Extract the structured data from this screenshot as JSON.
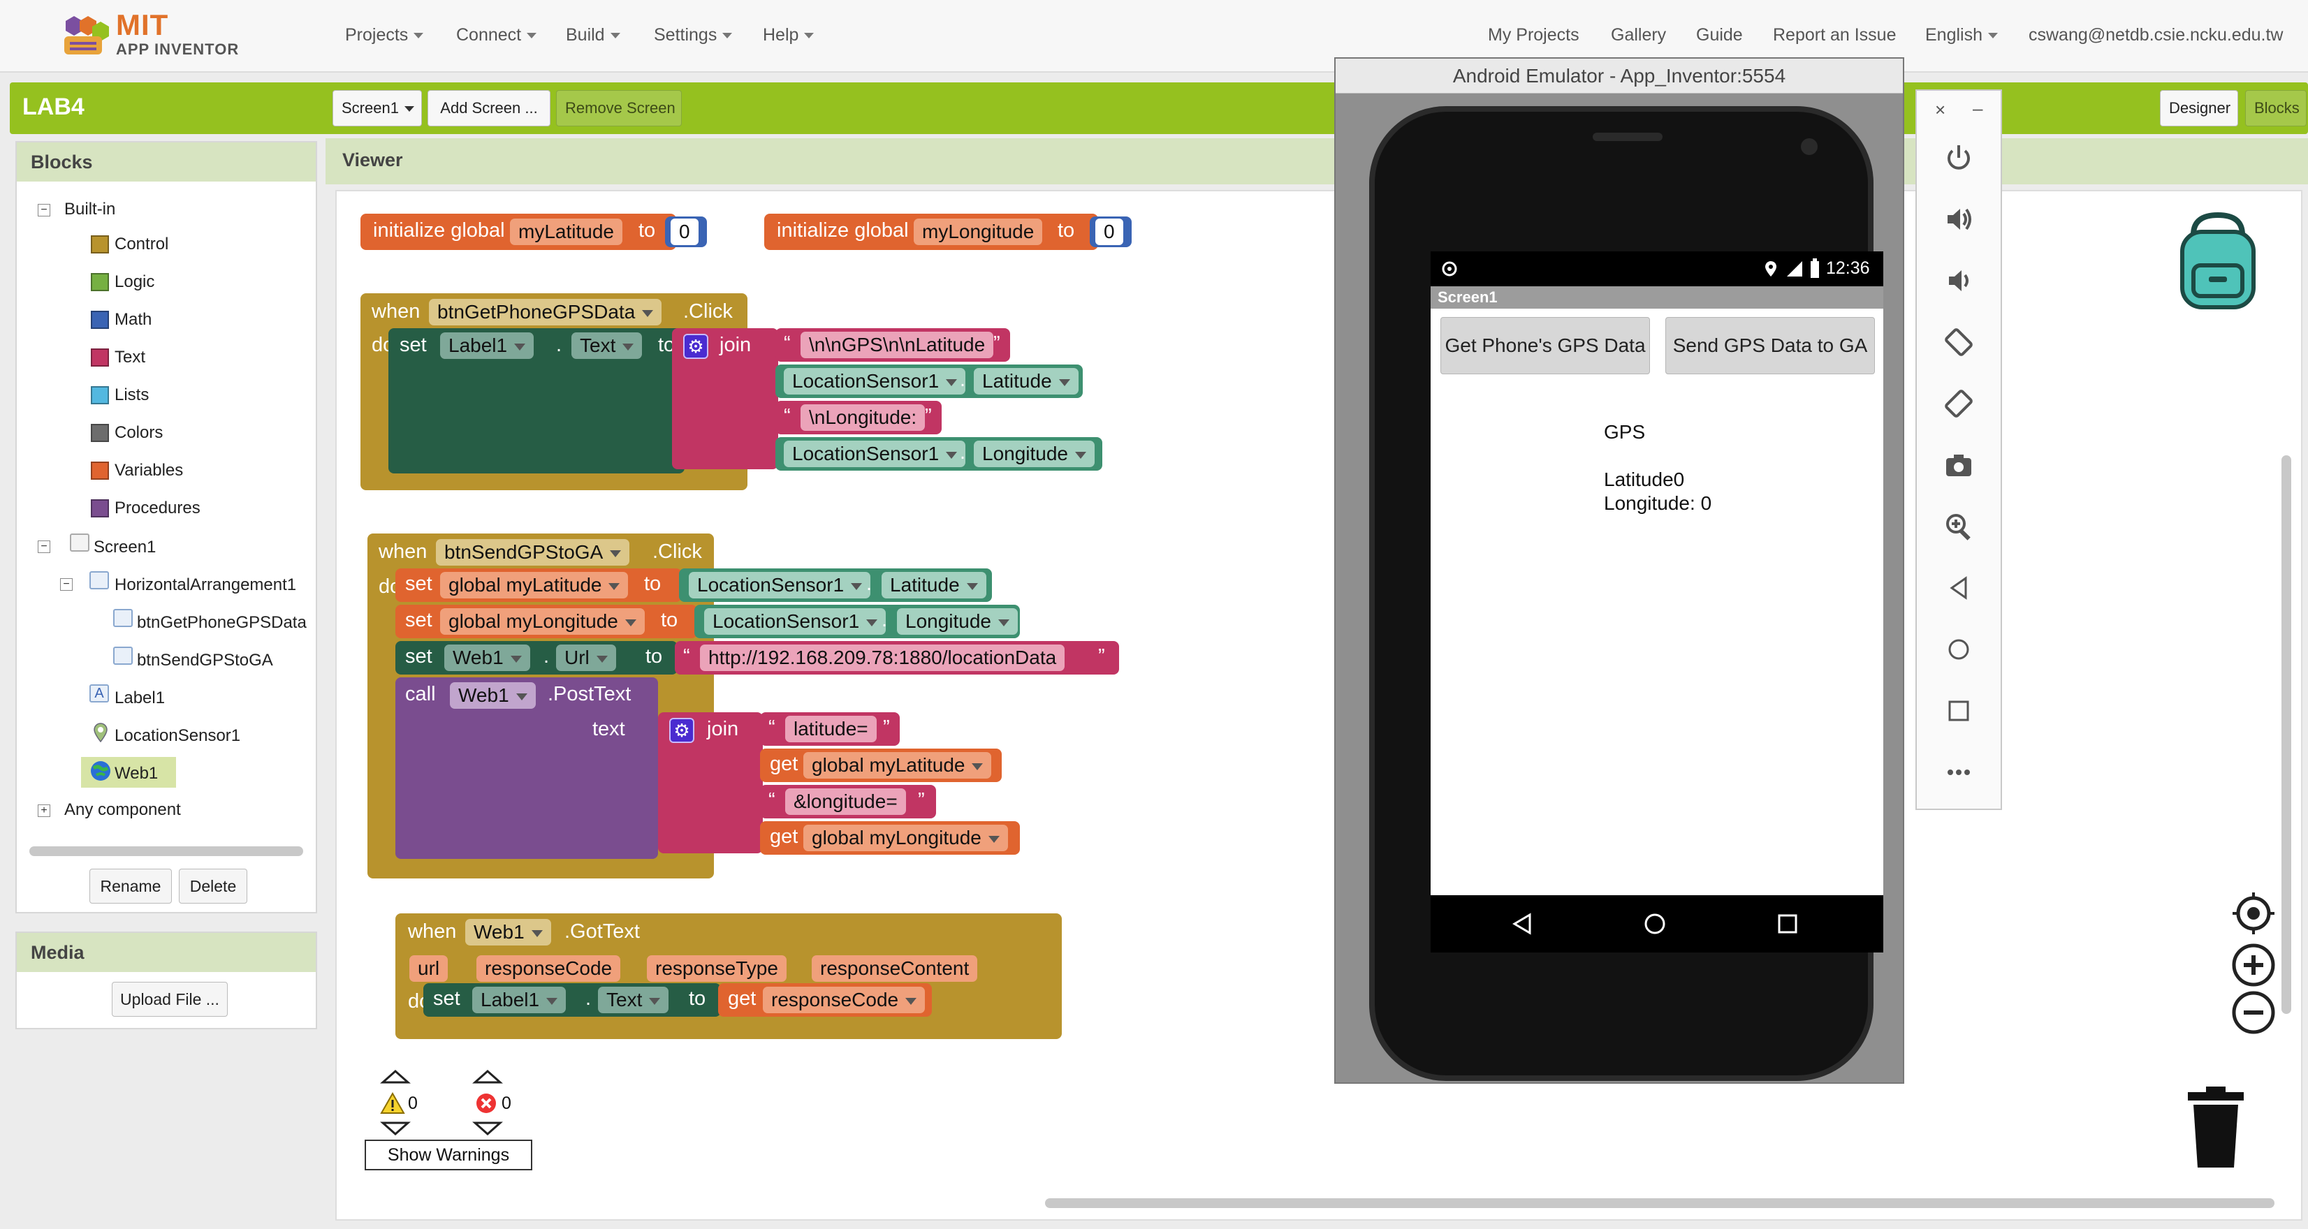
{
  "nav": {
    "logo_mit": "MIT",
    "logo_app": "APP INVENTOR",
    "left_menus": [
      "Projects",
      "Connect",
      "Build",
      "Settings",
      "Help"
    ],
    "right_links": [
      "My Projects",
      "Gallery",
      "Guide",
      "Report an Issue",
      "English",
      "cswang@netdb.csie.ncku.edu.tw"
    ]
  },
  "project": {
    "name": "LAB4",
    "screen_select": "Screen1",
    "add_screen": "Add Screen ...",
    "remove_screen": "Remove Screen",
    "designer": "Designer",
    "blocks": "Blocks"
  },
  "blocks_panel": {
    "title": "Blocks",
    "builtin": "Built-in",
    "builtin_items": [
      {
        "label": "Control",
        "color": "#b8932d"
      },
      {
        "label": "Logic",
        "color": "#76b042"
      },
      {
        "label": "Math",
        "color": "#3a64b4"
      },
      {
        "label": "Text",
        "color": "#c13563"
      },
      {
        "label": "Lists",
        "color": "#53b8e0"
      },
      {
        "label": "Colors",
        "color": "#6d6d6d"
      },
      {
        "label": "Variables",
        "color": "#e0642f"
      },
      {
        "label": "Procedures",
        "color": "#7a4d8f"
      }
    ],
    "screen": "Screen1",
    "components": [
      "HorizontalArrangement1",
      "btnGetPhoneGPSData",
      "btnSendGPStoGA",
      "Label1",
      "LocationSensor1",
      "Web1"
    ],
    "any_component": "Any component",
    "rename": "Rename",
    "delete": "Delete"
  },
  "media_panel": {
    "title": "Media",
    "upload": "Upload File ..."
  },
  "viewer": {
    "title": "Viewer"
  },
  "code": {
    "init1": {
      "kw": "initialize global",
      "name": "myLatitude",
      "to": "to",
      "value": "0"
    },
    "init2": {
      "kw": "initialize global",
      "name": "myLongitude",
      "to": "to",
      "value": "0"
    },
    "ev1": {
      "when": "when",
      "component": "btnGetPhoneGPSData",
      "event": ".Click",
      "do": "do",
      "set": "set",
      "target": "Label1",
      "prop": "Text",
      "to": "to",
      "join": "join",
      "s1": "\\n\\nGPS\\n\\nLatitude",
      "sensor1": "LocationSensor1",
      "p1": "Latitude",
      "s2": "\\nLongitude:",
      "sensor2": "LocationSensor1",
      "p2": "Longitude"
    },
    "ev2": {
      "when": "when",
      "component": "btnSendGPStoGA",
      "event": ".Click",
      "do": "do",
      "set1": "set",
      "var1": "global myLatitude",
      "to1": "to",
      "sensor1": "LocationSensor1",
      "p1": "Latitude",
      "set2": "set",
      "var2": "global myLongitude",
      "to2": "to",
      "sensor2": "LocationSensor1",
      "p2": "Longitude",
      "set3": "set",
      "web": "Web1",
      "prop": "Url",
      "to3": "to",
      "url": "http://192.168.209.78:1880/locationData",
      "call": "call",
      "web2": "Web1",
      "method": ".PostText",
      "text": "text",
      "join": "join",
      "s1": "latitude=",
      "get1": "get",
      "gvar1": "global myLatitude",
      "s2": "&longitude=",
      "get2": "get",
      "gvar2": "global myLongitude"
    },
    "ev3": {
      "when": "when",
      "component": "Web1",
      "event": ".GotText",
      "params": [
        "url",
        "responseCode",
        "responseType",
        "responseContent"
      ],
      "do": "do",
      "set": "set",
      "target": "Label1",
      "prop": "Text",
      "to": "to",
      "get": "get",
      "var": "responseCode"
    }
  },
  "warnings": {
    "warn_count": "0",
    "error_count": "0",
    "show_warnings": "Show Warnings"
  },
  "emulator": {
    "title": "Android Emulator - App_Inventor:5554",
    "time": "12:36",
    "app_title": "Screen1",
    "btn1": "Get Phone's GPS Data",
    "btn2": "Send GPS Data to GA",
    "label": "GPS\n\nLatitude0\nLongitude: 0"
  },
  "emulator_tools": [
    "power-icon",
    "volume-up-icon",
    "volume-down-icon",
    "rotate-left-icon",
    "rotate-right-icon",
    "camera-icon",
    "zoom-icon",
    "back-icon",
    "home-icon",
    "overview-icon",
    "more-icon"
  ]
}
